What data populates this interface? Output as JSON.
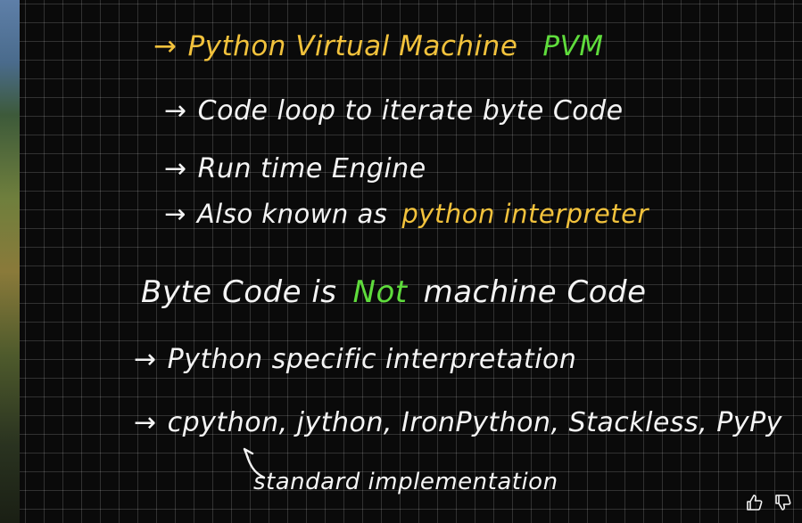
{
  "notes": {
    "pvm": {
      "arrow": "→",
      "title": "Python Virtual Machine",
      "acronym": "PVM"
    },
    "bullets": [
      {
        "arrow": "→",
        "text": "Code loop to iterate byte Code"
      },
      {
        "arrow": "→",
        "text": "Run time Engine"
      },
      {
        "arrow": "→",
        "prefix": "Also known as",
        "highlight": "python interpreter"
      }
    ],
    "bytecode_heading": {
      "part1": "Byte Code is",
      "highlight": "Not",
      "part2": "machine Code"
    },
    "bullets2": [
      {
        "arrow": "→",
        "text": "Python specific interpretation"
      },
      {
        "arrow": "→",
        "text": "cpython, jython, IronPython, Stackless, PyPy"
      }
    ],
    "annotation": "standard implementation"
  },
  "colors": {
    "white": "#f4f4f4",
    "yellow": "#f2c23c",
    "green": "#5fdc3c"
  },
  "controls": {
    "like_icon": "thumbs-up-icon",
    "dislike_icon": "thumbs-down-icon"
  }
}
